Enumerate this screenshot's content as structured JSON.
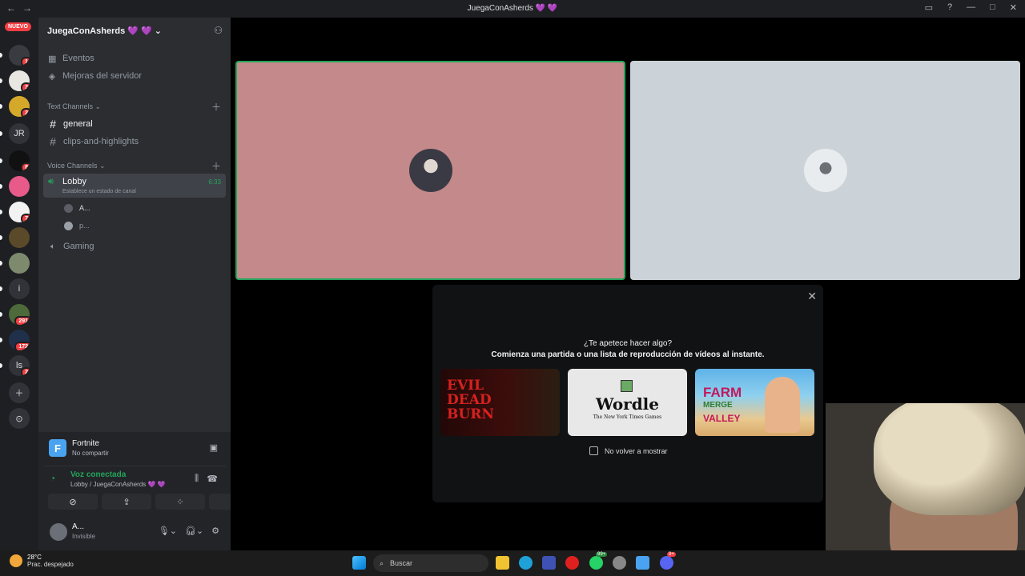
{
  "window": {
    "title": "JuegaConAsherds 💜 💜",
    "back": "←",
    "forward": "→"
  },
  "rail": {
    "new_badge": "NUEVO",
    "servers": [
      {
        "label": "",
        "badge": "1",
        "color": "#3a3b40"
      },
      {
        "label": "",
        "badge": "3",
        "color": "#e8e6e1"
      },
      {
        "label": "",
        "badge": "2",
        "color": "#d4a92a"
      },
      {
        "label": "JR",
        "badge": "",
        "color": "#313338"
      },
      {
        "label": "",
        "badge": "8",
        "color": "#111111"
      },
      {
        "label": "",
        "badge": "",
        "color": "#e75a8a"
      },
      {
        "label": "",
        "badge": "7",
        "color": "#f2f2f2"
      },
      {
        "label": "",
        "badge": "",
        "color": "#5a4a2a"
      },
      {
        "label": "",
        "badge": "",
        "color": "#7d8a6e"
      },
      {
        "label": "i",
        "badge": "",
        "color": "#313338"
      },
      {
        "label": "",
        "badge": "291",
        "color": "#4c6a3a"
      },
      {
        "label": "",
        "badge": "172",
        "color": "#20304a"
      },
      {
        "label": "ls",
        "badge": "2",
        "color": "#313338"
      }
    ]
  },
  "sidebar": {
    "server_name": "JuegaConAsherds 💜 💜",
    "events": "Eventos",
    "boosts": "Mejoras del servidor",
    "text_category": "Text Channels",
    "text_channels": [
      "general",
      "clips-and-highlights"
    ],
    "voice_category": "Voice Channels",
    "lobby": {
      "name": "Lobby",
      "status": "Establece un estado de canal",
      "time": "6:33"
    },
    "members": [
      "A...",
      "p..."
    ],
    "gaming": "Gaming"
  },
  "panel": {
    "activity_name": "Fortnite",
    "activity_status": "No compartir",
    "voice_title": "Voz conectada",
    "voice_sub": "Lobby / JuegaConAsherds 💜 💜",
    "user_name": "A...",
    "user_status": "Invisible"
  },
  "modal": {
    "title": "¿Te apetece hacer algo?",
    "subtitle": "Comienza una partida o una lista de reproducción de vídeos al instante.",
    "games": [
      {
        "line1": "EVIL",
        "line2": "DEAD",
        "line3": "BURN"
      },
      {
        "line1": "Wordle",
        "line2": "The New York Times Games"
      },
      {
        "line1": "FARM",
        "line2": "MERGE",
        "line3": "VALLEY"
      }
    ],
    "dont_show": "No volver a mostrar"
  },
  "taskbar": {
    "temp": "28°C",
    "weather": "Prac. despejado",
    "search": "Buscar",
    "whatsapp_badge": "99+",
    "discord_badge": "9+"
  }
}
